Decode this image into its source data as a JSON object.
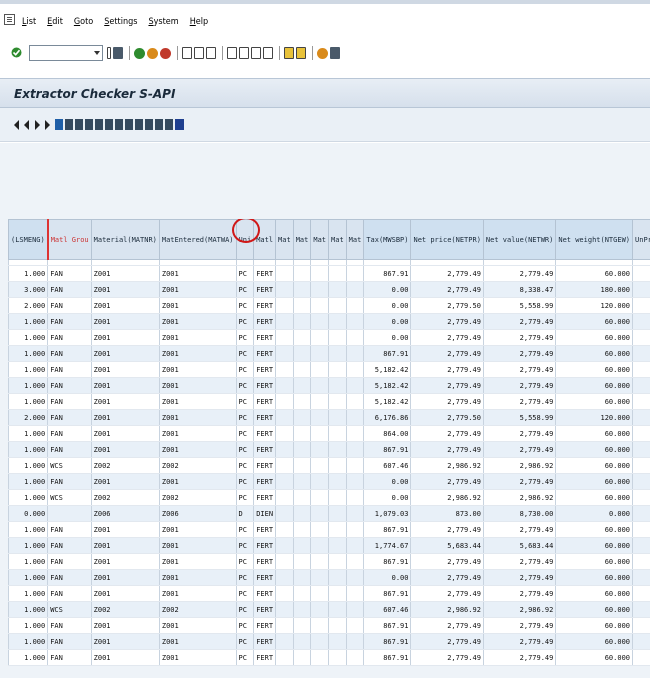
{
  "menu": {
    "items": [
      {
        "label": "List",
        "key": "L",
        "rest": "ist"
      },
      {
        "label": "Edit",
        "key": "E",
        "rest": "dit"
      },
      {
        "label": "Goto",
        "key": "G",
        "rest": "oto"
      },
      {
        "label": "Settings",
        "key": "S",
        "rest": "ettings"
      },
      {
        "label": "System",
        "key": "S",
        "rest": "ystem"
      },
      {
        "label": "Help",
        "key": "H",
        "rest": "elp"
      }
    ]
  },
  "toolbar": {
    "command_field_value": ""
  },
  "title": "Extractor Checker S-API",
  "grid": {
    "columns": [
      {
        "label": "(LSMENG)",
        "type": "num"
      },
      {
        "label": "Matl Grou",
        "type": "key"
      },
      {
        "label": "Material(MATNR)",
        "type": "key"
      },
      {
        "label": "MatEntered(MATWA)",
        "type": "key"
      },
      {
        "label": "Uni",
        "type": "key"
      },
      {
        "label": "Matl",
        "type": "key"
      },
      {
        "label": "Mat",
        "type": "key"
      },
      {
        "label": "Mat",
        "type": "key"
      },
      {
        "label": "Mat",
        "type": "key"
      },
      {
        "label": "Mat",
        "type": "key"
      },
      {
        "label": "Mat",
        "type": "key"
      },
      {
        "label": "Tax(MWSBP)",
        "type": "num"
      },
      {
        "label": "Net price(NETPR)",
        "type": "num"
      },
      {
        "label": "Net value(NETWR)",
        "type": "num"
      },
      {
        "label": "Net weight(NTGEW)",
        "type": "num"
      },
      {
        "label": "UnPrtNtWtD",
        "type": "key"
      }
    ],
    "rows": [
      [
        "1.000",
        "FAN",
        "Z001",
        "Z001",
        "PC",
        "FERT",
        "867.91",
        "2,779.49",
        "2,779.49",
        "60.000"
      ],
      [
        "3.000",
        "FAN",
        "Z001",
        "Z001",
        "PC",
        "FERT",
        "0.00",
        "2,779.49",
        "8,338.47",
        "180.000"
      ],
      [
        "2.000",
        "FAN",
        "Z001",
        "Z001",
        "PC",
        "FERT",
        "0.00",
        "2,779.50",
        "5,558.99",
        "120.000"
      ],
      [
        "1.000",
        "FAN",
        "Z001",
        "Z001",
        "PC",
        "FERT",
        "0.00",
        "2,779.49",
        "2,779.49",
        "60.000"
      ],
      [
        "1.000",
        "FAN",
        "Z001",
        "Z001",
        "PC",
        "FERT",
        "0.00",
        "2,779.49",
        "2,779.49",
        "60.000"
      ],
      [
        "1.000",
        "FAN",
        "Z001",
        "Z001",
        "PC",
        "FERT",
        "867.91",
        "2,779.49",
        "2,779.49",
        "60.000"
      ],
      [
        "1.000",
        "FAN",
        "Z001",
        "Z001",
        "PC",
        "FERT",
        "5,182.42",
        "2,779.49",
        "2,779.49",
        "60.000"
      ],
      [
        "1.000",
        "FAN",
        "Z001",
        "Z001",
        "PC",
        "FERT",
        "5,182.42",
        "2,779.49",
        "2,779.49",
        "60.000"
      ],
      [
        "1.000",
        "FAN",
        "Z001",
        "Z001",
        "PC",
        "FERT",
        "5,182.42",
        "2,779.49",
        "2,779.49",
        "60.000"
      ],
      [
        "2.000",
        "FAN",
        "Z001",
        "Z001",
        "PC",
        "FERT",
        "6,176.86",
        "2,779.50",
        "5,558.99",
        "120.000"
      ],
      [
        "1.000",
        "FAN",
        "Z001",
        "Z001",
        "PC",
        "FERT",
        "864.00",
        "2,779.49",
        "2,779.49",
        "60.000"
      ],
      [
        "1.000",
        "FAN",
        "Z001",
        "Z001",
        "PC",
        "FERT",
        "867.91",
        "2,779.49",
        "2,779.49",
        "60.000"
      ],
      [
        "1.000",
        "WCS",
        "Z002",
        "Z002",
        "PC",
        "FERT",
        "607.46",
        "2,986.92",
        "2,986.92",
        "60.000"
      ],
      [
        "1.000",
        "FAN",
        "Z001",
        "Z001",
        "PC",
        "FERT",
        "0.00",
        "2,779.49",
        "2,779.49",
        "60.000"
      ],
      [
        "1.000",
        "WCS",
        "Z002",
        "Z002",
        "PC",
        "FERT",
        "0.00",
        "2,986.92",
        "2,986.92",
        "60.000"
      ],
      [
        "0.000",
        "",
        "Z006",
        "Z006",
        "D",
        "DIEN",
        "1,079.03",
        "873.00",
        "8,730.00",
        "0.000"
      ],
      [
        "1.000",
        "FAN",
        "Z001",
        "Z001",
        "PC",
        "FERT",
        "867.91",
        "2,779.49",
        "2,779.49",
        "60.000"
      ],
      [
        "1.000",
        "FAN",
        "Z001",
        "Z001",
        "PC",
        "FERT",
        "1,774.67",
        "5,683.44",
        "5,683.44",
        "60.000"
      ],
      [
        "1.000",
        "FAN",
        "Z001",
        "Z001",
        "PC",
        "FERT",
        "867.91",
        "2,779.49",
        "2,779.49",
        "60.000"
      ],
      [
        "1.000",
        "FAN",
        "Z001",
        "Z001",
        "PC",
        "FERT",
        "0.00",
        "2,779.49",
        "2,779.49",
        "60.000"
      ],
      [
        "1.000",
        "FAN",
        "Z001",
        "Z001",
        "PC",
        "FERT",
        "867.91",
        "2,779.49",
        "2,779.49",
        "60.000"
      ],
      [
        "1.000",
        "WCS",
        "Z002",
        "Z002",
        "PC",
        "FERT",
        "607.46",
        "2,986.92",
        "2,986.92",
        "60.000"
      ],
      [
        "1.000",
        "FAN",
        "Z001",
        "Z001",
        "PC",
        "FERT",
        "867.91",
        "2,779.49",
        "2,779.49",
        "60.000"
      ],
      [
        "1.000",
        "FAN",
        "Z001",
        "Z001",
        "PC",
        "FERT",
        "867.91",
        "2,779.49",
        "2,779.49",
        "60.000"
      ],
      [
        "1.000",
        "FAN",
        "Z001",
        "Z001",
        "PC",
        "FERT",
        "867.91",
        "2,779.49",
        "2,779.49",
        "60.000"
      ]
    ]
  }
}
